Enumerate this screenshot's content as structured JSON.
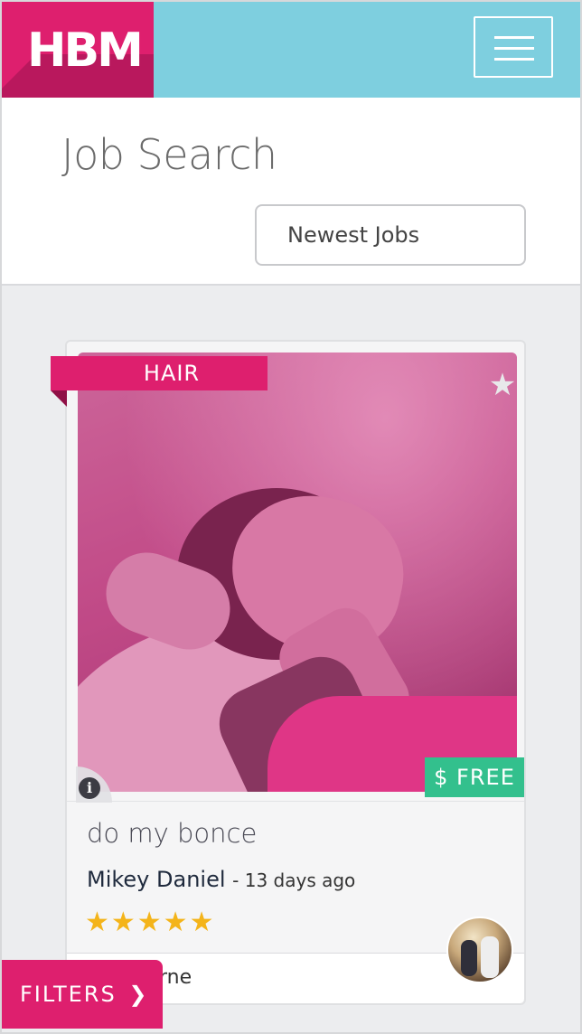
{
  "header": {
    "logo_text": "HBM",
    "menu_icon": "hamburger-icon",
    "brand_color": "#de1f6e",
    "bar_color": "#7ecfdf"
  },
  "title_panel": {
    "title": "Job Search",
    "sort_value": "Newest Jobs"
  },
  "job_card": {
    "category": "HAIR",
    "favorite_icon": "star-icon",
    "info_icon": "info-icon",
    "price_symbol": "$",
    "price_label": "FREE",
    "title": "do my bonce",
    "poster_name": "Mikey Daniel",
    "posted_ago": "- 13 days ago",
    "rating_stars": "★★★★★",
    "rating_value": 5,
    "location": "Melbourne"
  },
  "filters": {
    "label": "FILTERS",
    "chevron": "❯"
  }
}
